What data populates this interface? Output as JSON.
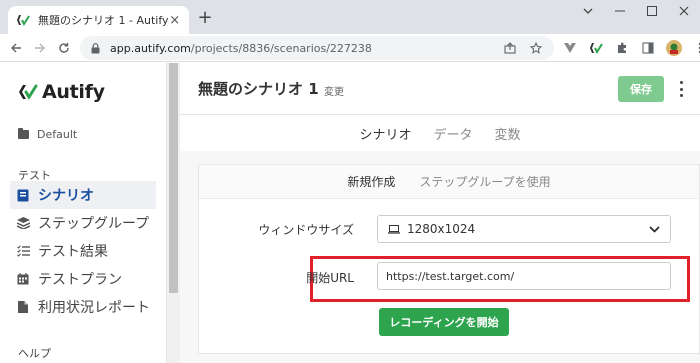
{
  "browser": {
    "tab_title": "無題のシナリオ 1 - Autify",
    "new_tab": "+",
    "close_tab": "×",
    "url_host": "app.autify.com",
    "url_path": "/projects/8836/scenarios/227238"
  },
  "app": {
    "brand": "Autify",
    "workspace": "Default",
    "nav_section": "テスト",
    "nav_items": [
      {
        "label": "シナリオ",
        "icon": "scenario-icon",
        "active": true
      },
      {
        "label": "ステップグループ",
        "icon": "layers-icon",
        "active": false
      },
      {
        "label": "テスト結果",
        "icon": "checklist-icon",
        "active": false
      },
      {
        "label": "テストプラン",
        "icon": "calendar-icon",
        "active": false
      },
      {
        "label": "利用状況レポート",
        "icon": "document-icon",
        "active": false
      }
    ],
    "help_section": "ヘルプ"
  },
  "header": {
    "title": "無題のシナリオ 1",
    "rename": "変更",
    "save": "保存"
  },
  "tabs": [
    "シナリオ",
    "データ",
    "変数"
  ],
  "panel": {
    "subtabs": [
      "新規作成",
      "ステップグループを使用"
    ],
    "window_size_label": "ウィンドウサイズ",
    "window_size_value": "1280x1024",
    "start_url_label": "開始URL",
    "start_url_value": "https://test.target.com/",
    "record_button": "レコーディングを開始"
  },
  "colors": {
    "accent_green": "#2ea44f",
    "save_green": "#7fca8f",
    "highlight_red": "#e0202b",
    "active_nav": "#1a4fa0"
  }
}
